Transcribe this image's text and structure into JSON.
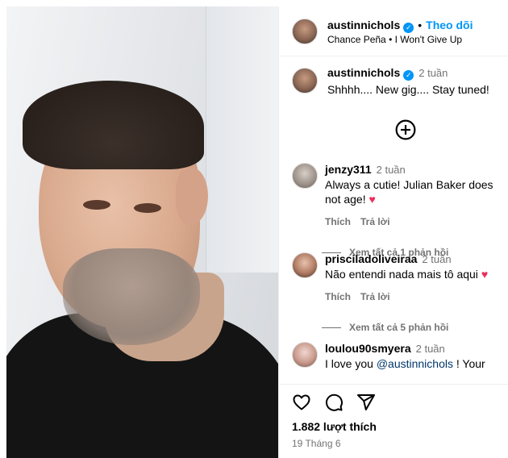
{
  "post": {
    "author": "austinnichols",
    "verified_icon": "verified-badge-icon",
    "follow_label": "Theo dõi",
    "dot": "•",
    "audio_artist": "Chance Peña",
    "audio_title": "I Won't Give Up",
    "caption": "Shhhh.... New gig.... Stay tuned!",
    "caption_time": "2 tuần",
    "likes": "1.882 lượt thích",
    "date": "19 Tháng 6"
  },
  "comments": [
    {
      "user": "jenzy311",
      "time": "2 tuần",
      "text": "Always a cutie! Julian Baker does not age!",
      "emoji": "♥",
      "like_label": "Thích",
      "reply_label": "Trả lời",
      "view_replies": "Xem tất cả 1 phản hồi"
    },
    {
      "user": "prisciladoliveiraa",
      "time": "2 tuần",
      "text": "Não entendi nada mais tô aqui",
      "emoji": "♥",
      "like_label": "Thích",
      "reply_label": "Trả lời",
      "view_replies": "Xem tất cả 5 phản hồi"
    },
    {
      "user": "loulou90smyera",
      "time": "2 tuần",
      "text_prefix": "I love you ",
      "mention": "@austinnichols",
      "text_suffix": " ! Your"
    }
  ],
  "icons": {
    "like": "heart-icon",
    "comment": "comment-icon",
    "share": "share-icon",
    "load_more": "plus-circle-icon"
  },
  "colors": {
    "accent": "#0095f6",
    "heart": "#ed2d5a",
    "muted": "#737373"
  }
}
